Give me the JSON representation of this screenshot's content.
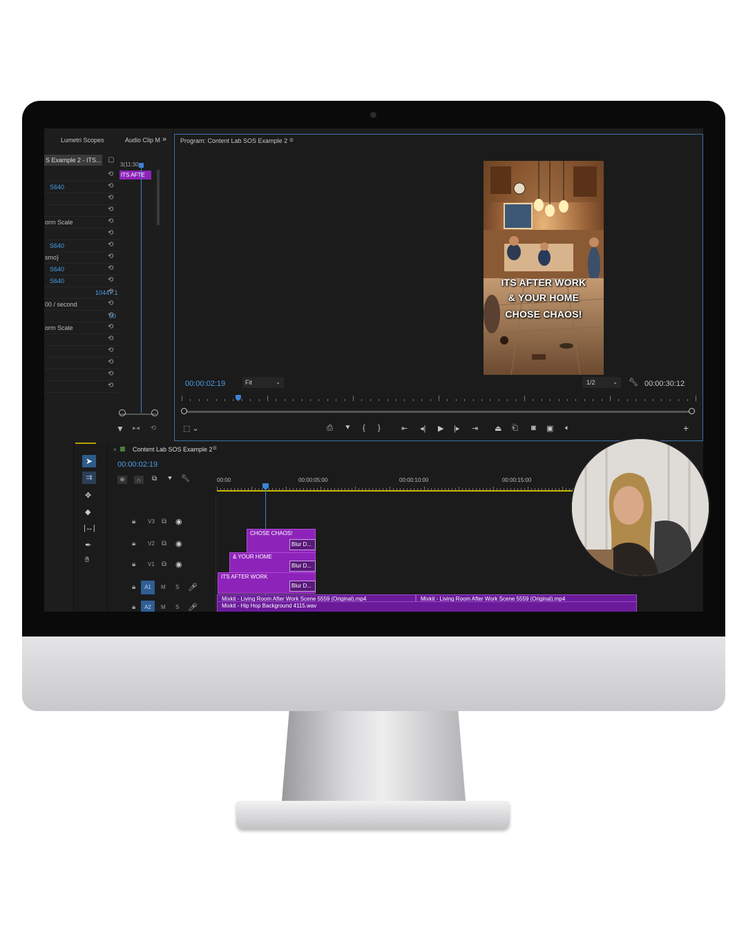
{
  "panels": {
    "lumetri_tab": "Lumetri Scopes",
    "audio_tab": "Audio Clip M",
    "more": "»",
    "program_tab": "Program: Content Lab SOS Example 2",
    "menu_icon": "≡"
  },
  "effect_controls": {
    "clip_name": "S Example 2 - ITS...",
    "mini_clip_label": "ITS AFTE",
    "mini_timecode": "3(11:30",
    "rows": [
      {
        "label": "",
        "value": ""
      },
      {
        "label": "",
        "value": "S640"
      },
      {
        "label": "",
        "value": ""
      },
      {
        "label": "",
        "value": ""
      },
      {
        "label": "orm Scale",
        "value": ""
      },
      {
        "label": "",
        "value": ""
      },
      {
        "label": "",
        "value": "S640"
      },
      {
        "label": "smo}",
        "value": ""
      },
      {
        "label": "",
        "value": "S640"
      },
      {
        "label": "",
        "value": "S640"
      },
      {
        "label": "",
        "value": "10447.1"
      },
      {
        "label": "00 / second",
        "value": ""
      },
      {
        "label": "",
        "value": "00"
      },
      {
        "label": "orm Scale",
        "value": ""
      },
      {
        "label": "",
        "value": ""
      },
      {
        "label": "",
        "value": ""
      },
      {
        "label": "",
        "value": ""
      },
      {
        "label": "",
        "value": ""
      },
      {
        "label": "",
        "value": ""
      }
    ]
  },
  "program": {
    "caption_lines": [
      "ITS AFTER WORK",
      "& YOUR HOME",
      "CHOSE CHAOS!"
    ],
    "current_timecode": "00:00:02:19",
    "zoom": "Fit",
    "resolution": "1/2",
    "duration": "00:00:30:12",
    "playhead_fraction": 0.11
  },
  "timeline": {
    "sequence_name": "Content Lab SOS Example 2",
    "current_timecode": "00:00:02:19",
    "ruler": [
      "00:00",
      "00:00:05:00",
      "00:00:10:00",
      "00:00:15:00"
    ],
    "video_tracks": [
      {
        "name": "V3",
        "clip": "CHOSE CHAOS!",
        "fx": "Blur D..."
      },
      {
        "name": "V2",
        "clip": "& YOUR HOME",
        "fx": "Blur D..."
      },
      {
        "name": "V1",
        "clip": "ITS AFTER WORK",
        "fx": "Blur D..."
      }
    ],
    "audio_tracks": [
      {
        "name": "A1",
        "clip_a": "Mixkit - Living Room After Work Scene 5559 (Original).mp4",
        "clip_b": "Mixkit - Living Room After Work Scene 5559 (Original).mp4"
      },
      {
        "name": "A2",
        "clip_a": "Mixkit - Hip Hop Background 4115.wav"
      }
    ],
    "track_buttons": {
      "mute": "M",
      "solo": "S"
    }
  },
  "colors": {
    "accent_blue": "#4a9fe8",
    "clip_purple": "#8e23b9",
    "audio_purple": "#6a1b9a",
    "panel_bg": "#1d1d1d"
  }
}
